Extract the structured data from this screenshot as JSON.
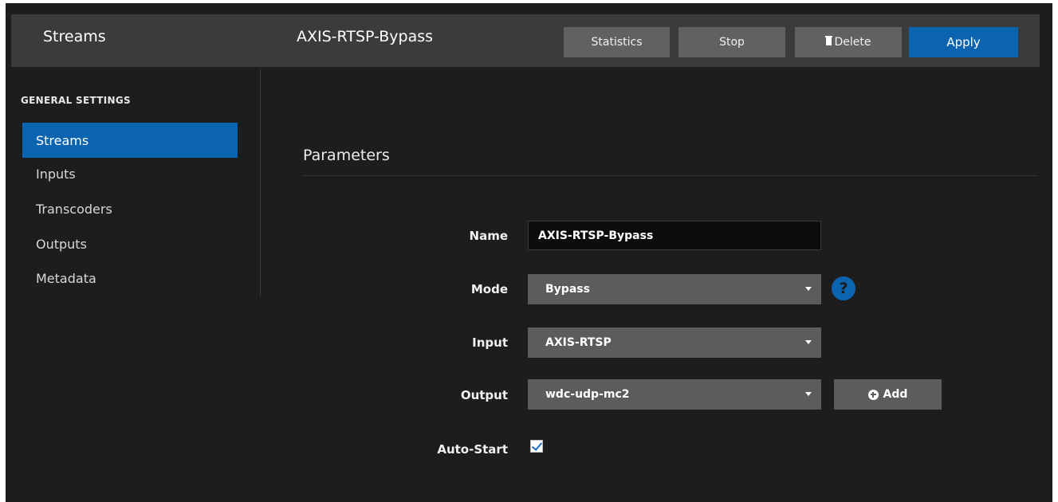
{
  "header": {
    "app_title": "Streams",
    "stream_name": "AXIS-RTSP-Bypass",
    "buttons": {
      "statistics": "Statistics",
      "stop": "Stop",
      "delete": "Delete",
      "apply": "Apply"
    }
  },
  "sidebar": {
    "section_label": "GENERAL SETTINGS",
    "items": [
      {
        "label": "Streams",
        "active": true
      },
      {
        "label": "Inputs"
      },
      {
        "label": "Transcoders"
      },
      {
        "label": "Outputs"
      },
      {
        "label": "Metadata"
      }
    ]
  },
  "main": {
    "section_title": "Parameters",
    "form": {
      "name_label": "Name",
      "name_value": "AXIS-RTSP-Bypass",
      "mode_label": "Mode",
      "mode_value": "Bypass",
      "input_label": "Input",
      "input_value": "AXIS-RTSP",
      "output_label": "Output",
      "output_value": "wdc-udp-mc2",
      "add_label": "Add",
      "autostart_label": "Auto-Start",
      "autostart_checked": true,
      "help_symbol": "?"
    }
  },
  "colors": {
    "accent": "#0a64b0",
    "background": "#1d1d1d",
    "header": "#3b3b3b",
    "control": "#5c5c5c"
  },
  "icons": [
    "trash-icon",
    "chevron-down-icon",
    "help-icon",
    "plus-circle-icon",
    "check-icon"
  ]
}
